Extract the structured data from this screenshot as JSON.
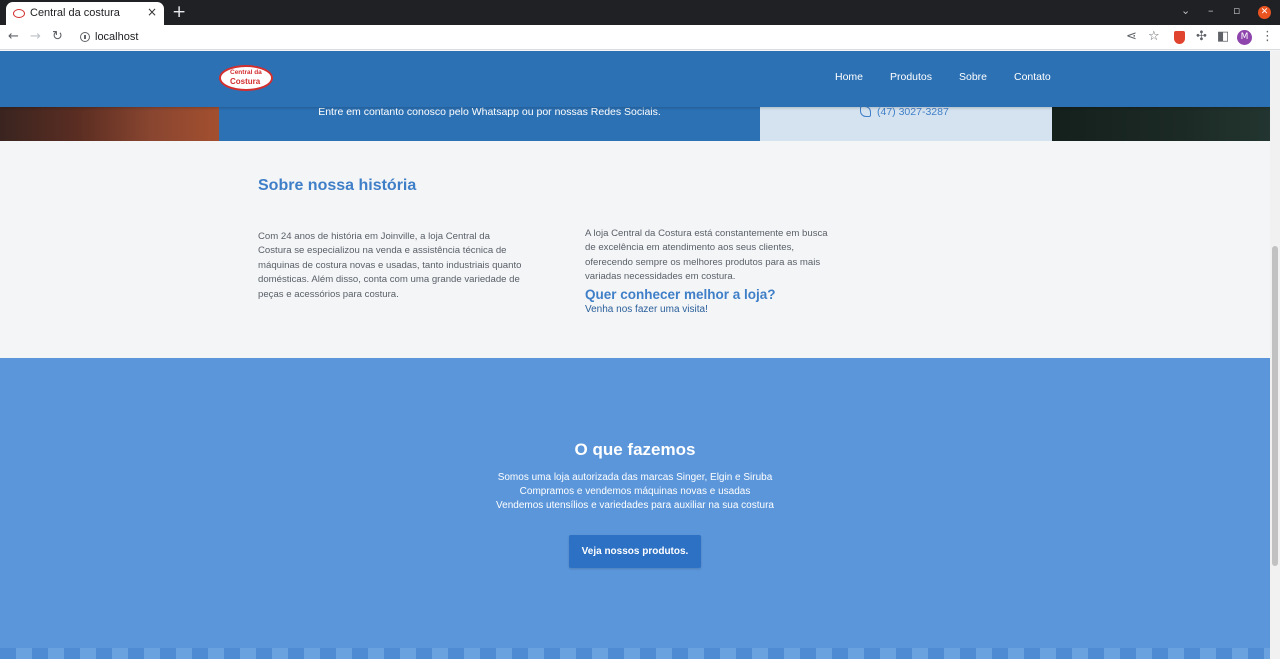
{
  "browser": {
    "tab_title": "Central da costura",
    "tab_close": "×",
    "new_tab": "+",
    "url": "localhost",
    "profile_initial": "M",
    "window_close": "✕"
  },
  "header": {
    "logo_line1": "Central da",
    "logo_line2": "Costura",
    "nav": [
      "Home",
      "Produtos",
      "Sobre",
      "Contato"
    ]
  },
  "hero": {
    "cta_text": "Entre em contanto conosco pelo Whatsapp ou por nossas Redes Sociais.",
    "phone": "(47) 3027-3287"
  },
  "about": {
    "title": "Sobre nossa história",
    "paragraph1": "Com 24 anos de história em Joinville, a loja Central da Costura se especializou na venda e assistência técnica de máquinas de costura novas e usadas, tanto industriais quanto domésticas. Além disso, conta com uma grande variedade de peças e acessórios para costura.",
    "paragraph2": "A loja Central da Costura está constantemente em busca de excelência em atendimento aos seus clientes, oferecendo sempre os melhores produtos para as mais variadas necessidades em costura.",
    "question": "Quer conhecer melhor a loja?",
    "visit": "Venha nos fazer uma visita!"
  },
  "services": {
    "title": "O que fazemos",
    "lines": [
      "Somos uma loja autorizada das marcas Singer, Elgin e Siruba",
      "Compramos e vendemos máquinas novas e usadas",
      "Vendemos utensílios e variedades para auxiliar na sua costura"
    ],
    "button": "Veja nossos produtos."
  },
  "colors": {
    "primary_blue": "#2c71b4",
    "services_bg": "#5b96da",
    "accent_text": "#3f7fc8",
    "logo_red": "#d32f2f"
  }
}
